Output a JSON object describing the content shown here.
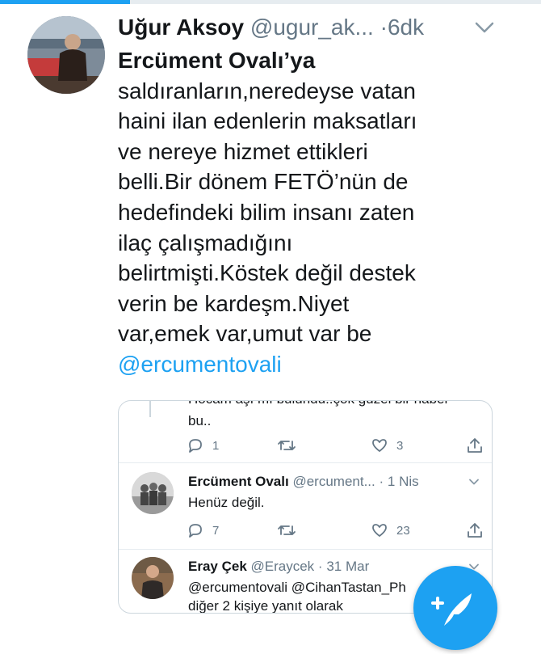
{
  "top_progress": {
    "value": 0.24
  },
  "tweet": {
    "author_name": "Uğur Aksoy",
    "author_handle": "@ugur_ak...",
    "separator": "·",
    "time": "6dk",
    "text_lines": [
      "Ercüment Ovalı’ya",
      "saldıranların,neredeyse vatan",
      "haini ilan edenlerin maksatları",
      "ve nereye hizmet ettikleri",
      "belli.Bir dönem FETÖ’nün de",
      "hedefindeki bilim insanı zaten",
      "ilaç çalışmadığını",
      "belirtmişti.Köstek değil destek",
      "verin be kardeşm.Niyet",
      "var,emek var,umut var be"
    ],
    "mention": "@ercumentovali"
  },
  "quoted": {
    "cutoff_text": "Hocam aşı mı bulundu..çok güzel bir haber",
    "first_tail": "bu..",
    "first_actions": {
      "reply_count": "1",
      "retweet_count": "",
      "like_count": "3"
    },
    "reply1": {
      "name": "Ercüment Ovalı",
      "handle": "@ercument...",
      "separator": "·",
      "date": "1 Nis",
      "text": "Henüz değil.",
      "actions": {
        "reply_count": "7",
        "retweet_count": "",
        "like_count": "23"
      }
    },
    "reply2": {
      "name": "Eray Çek",
      "handle": "@Eraycek",
      "separator": "·",
      "date": "31 Mar",
      "mentions": "@ercumentovali @CihanTastan_Ph",
      "replying_note": "diğer 2 kişiye yanıt olarak"
    }
  },
  "fab": {
    "icon": "compose-tweet-icon"
  },
  "colors": {
    "accent": "#1da1f2",
    "text": "#14171a",
    "muted": "#657786",
    "border": "#ccd6dd"
  }
}
